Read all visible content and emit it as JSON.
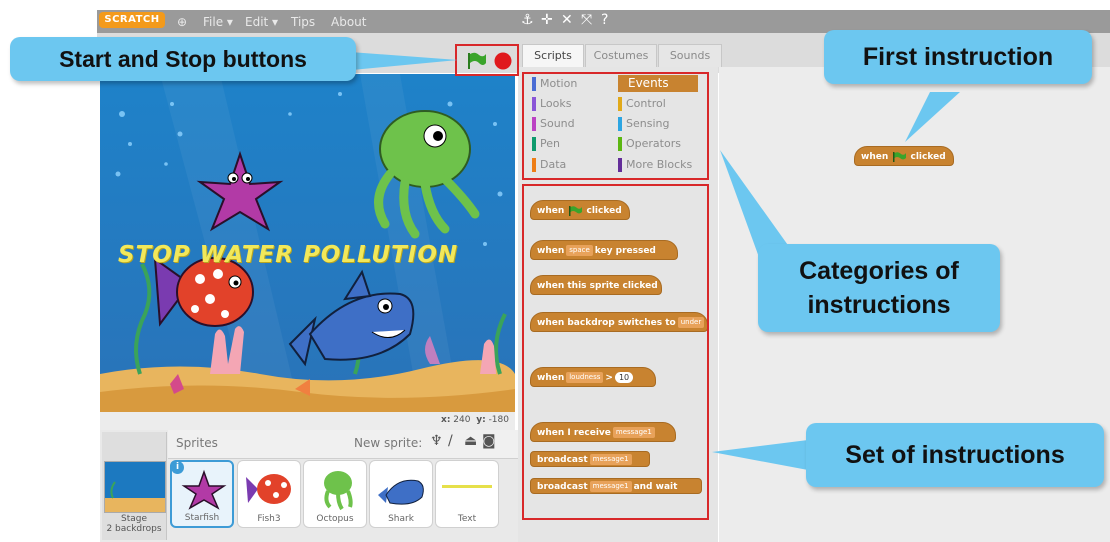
{
  "menubar": {
    "logo": "SCRATCH",
    "file": "File ▾",
    "edit": "Edit ▾",
    "tips": "Tips",
    "about": "About"
  },
  "tabs": {
    "scripts": "Scripts",
    "costumes": "Costumes",
    "sounds": "Sounds"
  },
  "categories": {
    "left": [
      "Motion",
      "Looks",
      "Sound",
      "Pen",
      "Data"
    ],
    "right": [
      "Events",
      "Control",
      "Sensing",
      "Operators",
      "More Blocks"
    ],
    "active": "Events",
    "colors": {
      "Motion": "#4a6cd4",
      "Looks": "#8a55d7",
      "Sound": "#bb42c3",
      "Pen": "#0e9a6c",
      "Data": "#ee7d16",
      "Events": "#c88330",
      "Control": "#e1a91a",
      "Sensing": "#2ca5e2",
      "Operators": "#5cb712",
      "More Blocks": "#632d99"
    }
  },
  "blocks": {
    "when_flag_clicked": {
      "pre": "when",
      "post": "clicked"
    },
    "key_pressed": {
      "pre": "when",
      "slot": "space",
      "post": "key pressed"
    },
    "sprite_clicked": "when this sprite clicked",
    "backdrop_switches": {
      "pre": "when backdrop switches to",
      "slot": "under"
    },
    "loudness": {
      "pre": "when",
      "slot": "loudness",
      "op": ">",
      "num": "10"
    },
    "receive": {
      "pre": "when I receive",
      "slot": "message1"
    },
    "broadcast": {
      "pre": "broadcast",
      "slot": "message1"
    },
    "broadcast_wait": {
      "pre": "broadcast",
      "slot": "message1",
      "post": "and wait"
    }
  },
  "script_block": {
    "pre": "when",
    "post": "clicked"
  },
  "stage": {
    "title_text": "STOP WATER POLLUTION",
    "coords": {
      "x_label": "x:",
      "x": "240",
      "y_label": "y:",
      "y": "-180"
    }
  },
  "sprites_panel": {
    "label": "Sprites",
    "new_sprite": "New sprite:",
    "stage_label": "Stage",
    "stage_sub": "2 backdrops",
    "items": [
      "Starfish",
      "Fish3",
      "Octopus",
      "Shark",
      "Text"
    ],
    "selected": "Starfish"
  },
  "callouts": {
    "start_stop": "Start and Stop buttons",
    "first_instruction": "First instruction",
    "categories": "Categories of instructions",
    "set": "Set of instructions"
  },
  "accent_colors": {
    "callout": "#6cc7f0",
    "highlight": "#d8282a",
    "event_block": "#c88330"
  }
}
